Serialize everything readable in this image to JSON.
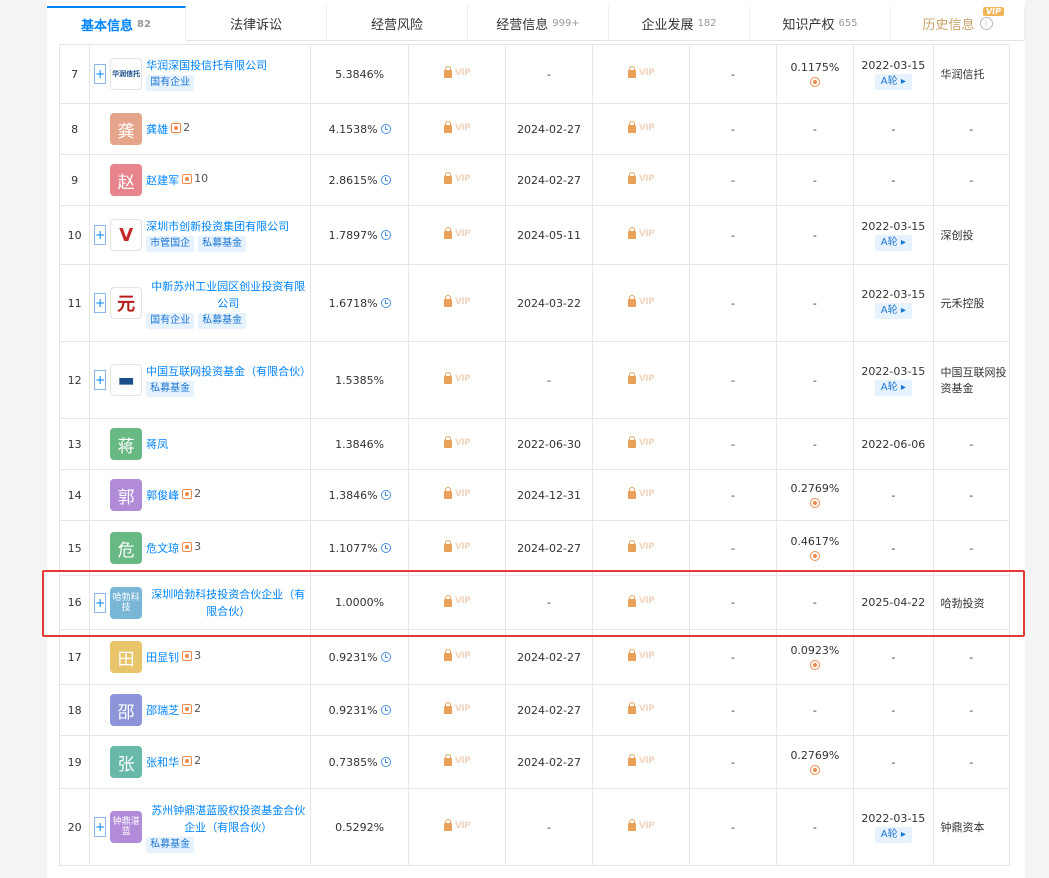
{
  "tabs": [
    {
      "label": "基本信息",
      "count": "82",
      "active": true
    },
    {
      "label": "法律诉讼",
      "count": ""
    },
    {
      "label": "经营风险",
      "count": ""
    },
    {
      "label": "经营信息",
      "count": "999+"
    },
    {
      "label": "企业发展",
      "count": "182"
    },
    {
      "label": "知识产权",
      "count": "655"
    },
    {
      "label": "历史信息",
      "count": "",
      "vip": "VIP"
    }
  ],
  "vip_text": "VIP",
  "colors": {
    "accent": "#0084ff",
    "highlight": "#e53935"
  },
  "rows": [
    {
      "idx": "7",
      "name": "华润深国投信托有限公司",
      "expand": true,
      "logo": "company",
      "logo_text": "华润信托",
      "tags": [
        "国有企业"
      ],
      "pct": "5.3846%",
      "clock": false,
      "date1": "-",
      "c6": "-",
      "ip": "0.1175%",
      "ip_icon": true,
      "date2": "2022-03-15",
      "round": "A轮 ▸",
      "brand": "华润信托"
    },
    {
      "idx": "8",
      "name": "龚雄",
      "expand": false,
      "logo": "person",
      "logo_text": "龚",
      "logo_color": "#e4a58a",
      "rel": "2",
      "pct": "4.1538%",
      "clock": true,
      "date1": "2024-02-27",
      "c6": "-",
      "ip": "-",
      "date2": "-",
      "brand": "-"
    },
    {
      "idx": "9",
      "name": "赵建军",
      "expand": false,
      "logo": "person",
      "logo_text": "赵",
      "logo_color": "#e8848c",
      "rel": "10",
      "pct": "2.8615%",
      "clock": true,
      "date1": "2024-02-27",
      "c6": "-",
      "ip": "-",
      "date2": "-",
      "brand": "-"
    },
    {
      "idx": "10",
      "name": "深圳市创新投资集团有限公司",
      "expand": true,
      "logo": "company",
      "logo_text": "V",
      "tags": [
        "市管国企",
        "私募基金"
      ],
      "pct": "1.7897%",
      "clock": true,
      "date1": "2024-05-11",
      "c6": "-",
      "ip": "-",
      "date2": "2022-03-15",
      "round": "A轮 ▸",
      "brand": "深创投"
    },
    {
      "idx": "11",
      "name": "中新苏州工业园区创业投资有限公司",
      "expand": true,
      "logo": "company",
      "logo_text": "元",
      "tags": [
        "国有企业",
        "私募基金"
      ],
      "pct": "1.6718%",
      "clock": true,
      "date1": "2024-03-22",
      "c6": "-",
      "ip": "-",
      "date2": "2022-03-15",
      "round": "A轮 ▸",
      "brand": "元禾控股"
    },
    {
      "idx": "12",
      "name": "中国互联网投资基金（有限合伙）",
      "expand": true,
      "logo": "company",
      "logo_text": "▬",
      "tags": [
        "私募基金"
      ],
      "pct": "1.5385%",
      "clock": false,
      "date1": "-",
      "c6": "-",
      "ip": "-",
      "date2": "2022-03-15",
      "round": "A轮 ▸",
      "brand": "中国互联网投资基金"
    },
    {
      "idx": "13",
      "name": "蒋凤",
      "expand": false,
      "logo": "person",
      "logo_text": "蒋",
      "logo_color": "#69b984",
      "pct": "1.3846%",
      "clock": false,
      "date1": "2022-06-30",
      "c6": "-",
      "ip": "-",
      "date2": "2022-06-06",
      "brand": "-"
    },
    {
      "idx": "14",
      "name": "郭俊峰",
      "expand": false,
      "logo": "person",
      "logo_text": "郭",
      "logo_color": "#b28bd8",
      "rel": "2",
      "pct": "1.3846%",
      "clock": true,
      "date1": "2024-12-31",
      "c6": "-",
      "ip": "0.2769%",
      "ip_icon": true,
      "date2": "-",
      "brand": "-"
    },
    {
      "idx": "15",
      "name": "危文琼",
      "expand": false,
      "logo": "person",
      "logo_text": "危",
      "logo_color": "#69b984",
      "rel": "3",
      "pct": "1.1077%",
      "clock": true,
      "date1": "2024-02-27",
      "c6": "-",
      "ip": "0.4617%",
      "ip_icon": true,
      "date2": "-",
      "brand": "-"
    },
    {
      "idx": "16",
      "name": "深圳哈勃科技投资合伙企业（有限合伙）",
      "expand": true,
      "logo": "text",
      "logo_text": "哈勃科技",
      "logo_color": "#7ab6d6",
      "pct": "1.0000%",
      "clock": false,
      "date1": "-",
      "c6": "-",
      "ip": "-",
      "date2": "2025-04-22",
      "brand": "哈勃投资"
    },
    {
      "idx": "17",
      "name": "田显钊",
      "expand": false,
      "logo": "person",
      "logo_text": "田",
      "logo_color": "#e8c56a",
      "rel": "3",
      "pct": "0.9231%",
      "clock": true,
      "date1": "2024-02-27",
      "c6": "-",
      "ip": "0.0923%",
      "ip_icon": true,
      "date2": "-",
      "brand": "-"
    },
    {
      "idx": "18",
      "name": "邵瑞芝",
      "expand": false,
      "logo": "person",
      "logo_text": "邵",
      "logo_color": "#8b95d8",
      "rel": "2",
      "pct": "0.9231%",
      "clock": true,
      "date1": "2024-02-27",
      "c6": "-",
      "ip": "-",
      "date2": "-",
      "brand": "-"
    },
    {
      "idx": "19",
      "name": "张和华",
      "expand": false,
      "logo": "person",
      "logo_text": "张",
      "logo_color": "#69b9a8",
      "rel": "2",
      "pct": "0.7385%",
      "clock": true,
      "date1": "2024-02-27",
      "c6": "-",
      "ip": "0.2769%",
      "ip_icon": true,
      "date2": "-",
      "brand": "-"
    },
    {
      "idx": "20",
      "name": "苏州钟鼎湛蓝股权投资基金合伙企业（有限合伙）",
      "expand": true,
      "logo": "text",
      "logo_text": "钟鼎湛蓝",
      "logo_color": "#b28bd8",
      "tags": [
        "私募基金"
      ],
      "pct": "0.5292%",
      "clock": false,
      "date1": "-",
      "c6": "-",
      "ip": "-",
      "date2": "2022-03-15",
      "round": "A轮 ▸",
      "brand": "钟鼎资本"
    }
  ]
}
